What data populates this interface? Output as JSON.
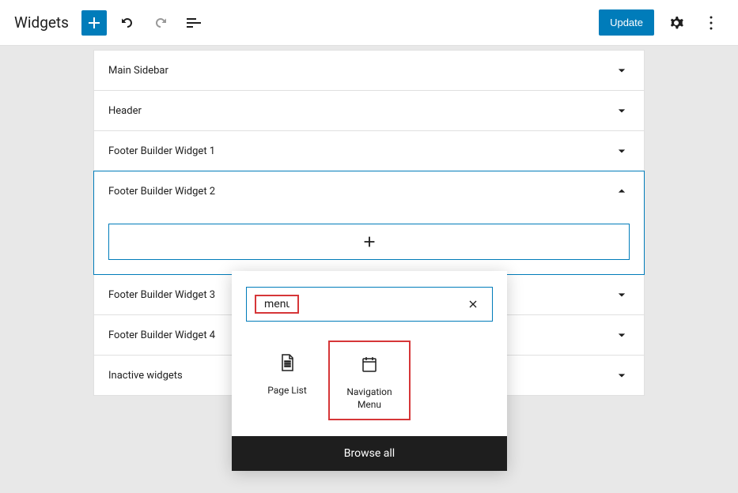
{
  "toolbar": {
    "title": "Widgets",
    "update_label": "Update"
  },
  "panels": {
    "main_sidebar": "Main Sidebar",
    "header": "Header",
    "footer1": "Footer Builder Widget 1",
    "footer2": "Footer Builder Widget 2",
    "footer3": "Footer Builder Widget 3",
    "footer4": "Footer Builder Widget 4",
    "inactive": "Inactive widgets"
  },
  "inserter": {
    "search_value": "menu",
    "blocks": {
      "page_list": "Page List",
      "nav_menu": "Navigation Menu"
    },
    "browse_all": "Browse all"
  }
}
